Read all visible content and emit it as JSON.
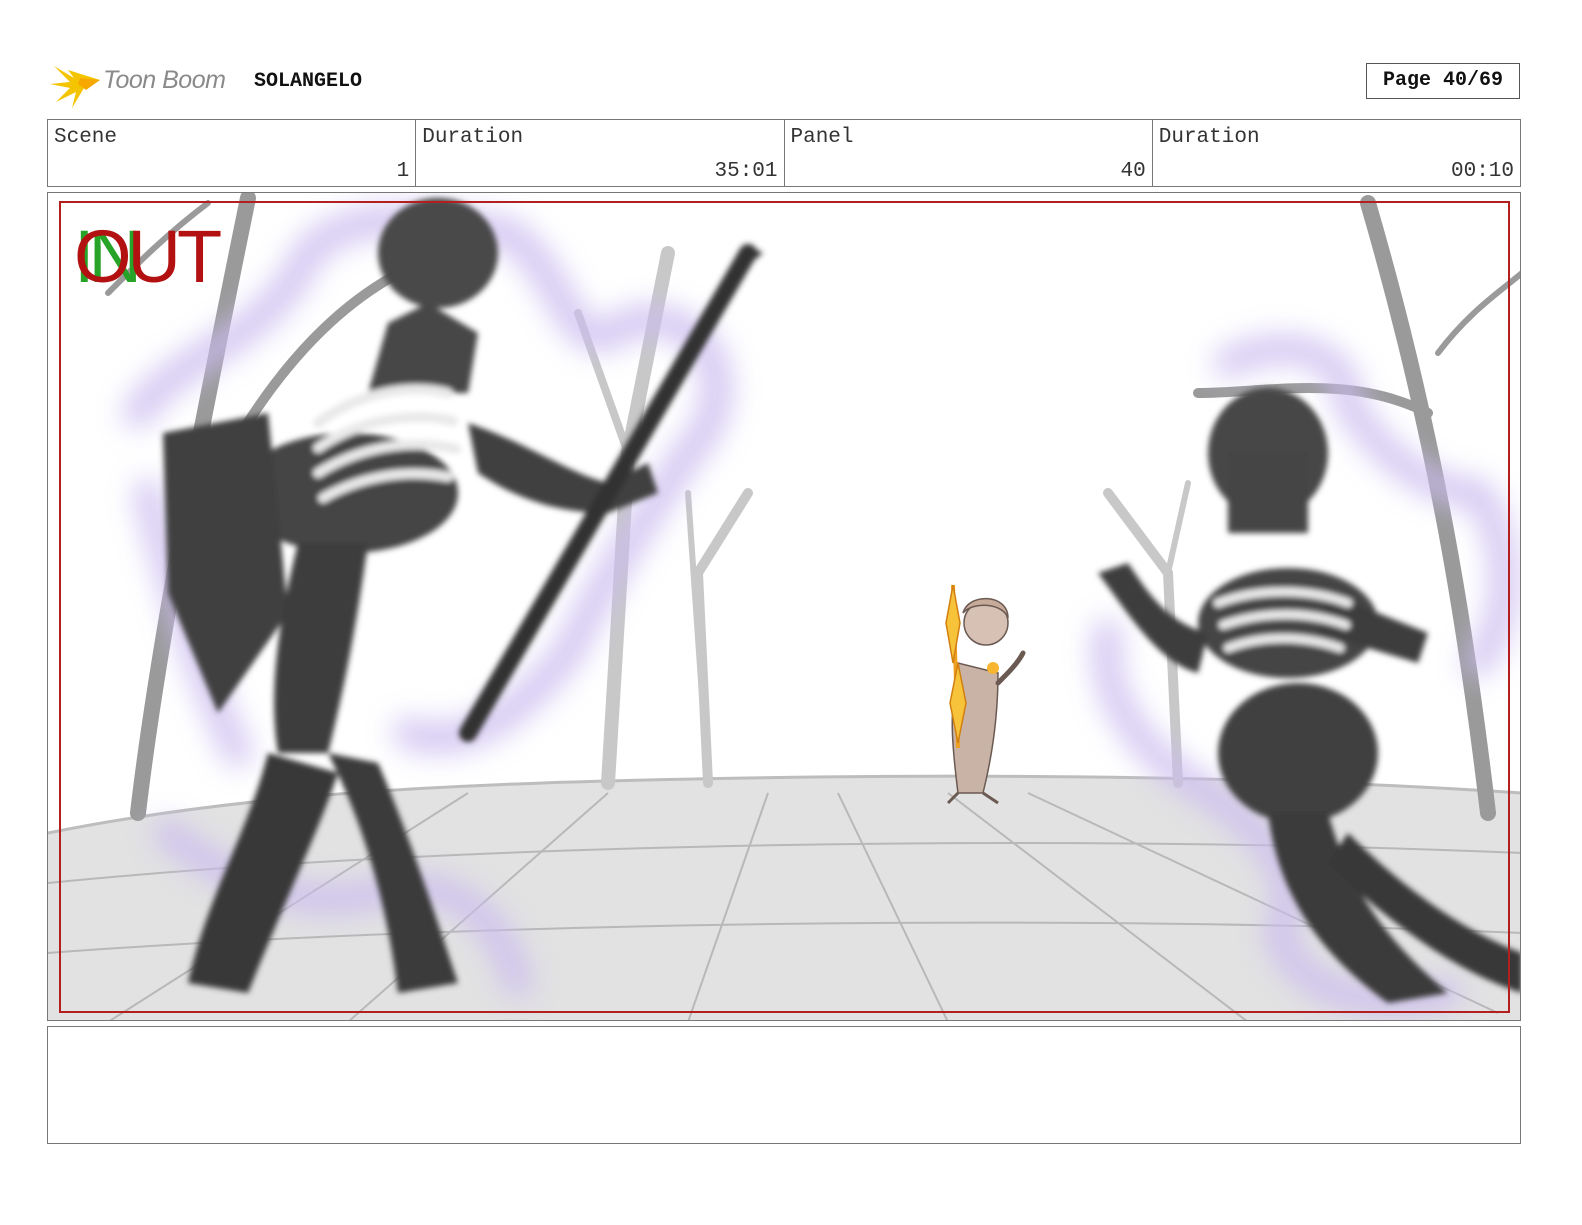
{
  "header": {
    "logo_text": "Toon Boom",
    "project_name": "SOLANGELO",
    "page_label": "Page 40/69"
  },
  "info": {
    "scene_label": "Scene",
    "scene_value": "1",
    "scene_duration_label": "Duration",
    "scene_duration_value": "35:01",
    "panel_label": "Panel",
    "panel_value": "40",
    "panel_duration_label": "Duration",
    "panel_duration_value": "00:10"
  },
  "panel": {
    "in_tag": "IN",
    "out_tag": "OUT"
  },
  "notes": {
    "text": ""
  }
}
